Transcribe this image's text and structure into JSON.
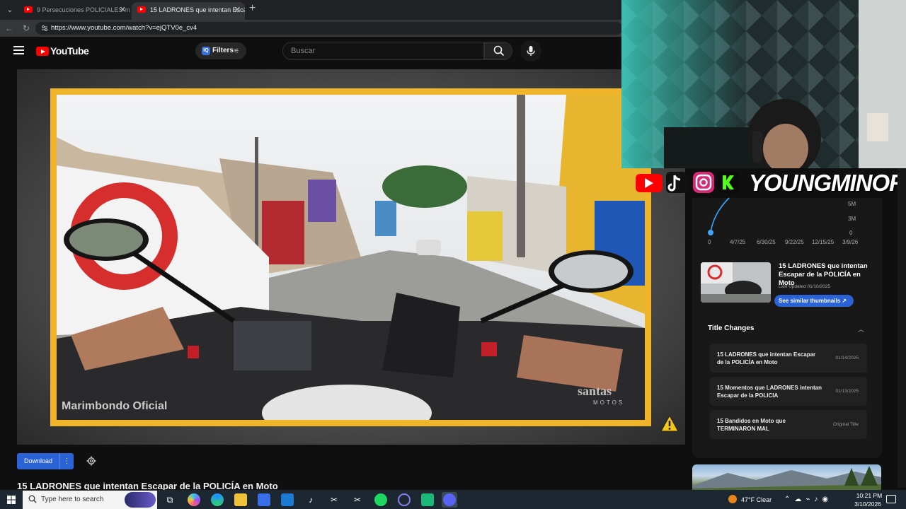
{
  "browser": {
    "tabs": [
      {
        "label": "9 Persecuciones POLICIALES muy"
      },
      {
        "label": "15 LADRONES que intentan Escap"
      }
    ],
    "url": "https://www.youtube.com/watch?v=ejQTV0e_cv4"
  },
  "youtube": {
    "logo_text": "YouTube",
    "filters_label": "Filters",
    "search_placeholder": "Buscar"
  },
  "player": {
    "watermark_left": "Marimbondo Oficial",
    "watermark_right": "santas",
    "watermark_right_sub": "MOTOS"
  },
  "below_player": {
    "download_label": "Download",
    "video_title": "15 LADRONES que intentan Escapar de la POLICÍA en Moto"
  },
  "overlay": {
    "streamer_name": "YOUNGMINOR"
  },
  "right_panel": {
    "chart_data": {
      "type": "line",
      "x_ticks": [
        "0",
        "4/7/25",
        "6/30/25",
        "9/22/25",
        "12/15/25",
        "3/9/26"
      ],
      "y_ticks": [
        "5M",
        "3M",
        "0"
      ]
    },
    "thumb_card": {
      "title": "15 LADRONES que intentan Escapar de la POLICÍA en Moto",
      "last_updated": "Last Updated 01/10/2025",
      "similar_label": "See similar thumbnails"
    },
    "title_changes": {
      "header": "Title Changes",
      "rows": [
        {
          "title": "15 LADRONES que intentan Escapar de la POLICÍA en Moto",
          "date": "01/14/2025"
        },
        {
          "title": "15 Momentos que LADRONES intentan Escapar de la POLICIA",
          "date": "01/13/2025"
        },
        {
          "title": "15 Bandidos en Moto que TERMINARON MAL",
          "date": "Original Title"
        }
      ]
    }
  },
  "taskbar": {
    "search_placeholder": "Type here to search",
    "weather": "47°F  Clear",
    "time": "10:21 PM",
    "date": "3/10/2026"
  }
}
